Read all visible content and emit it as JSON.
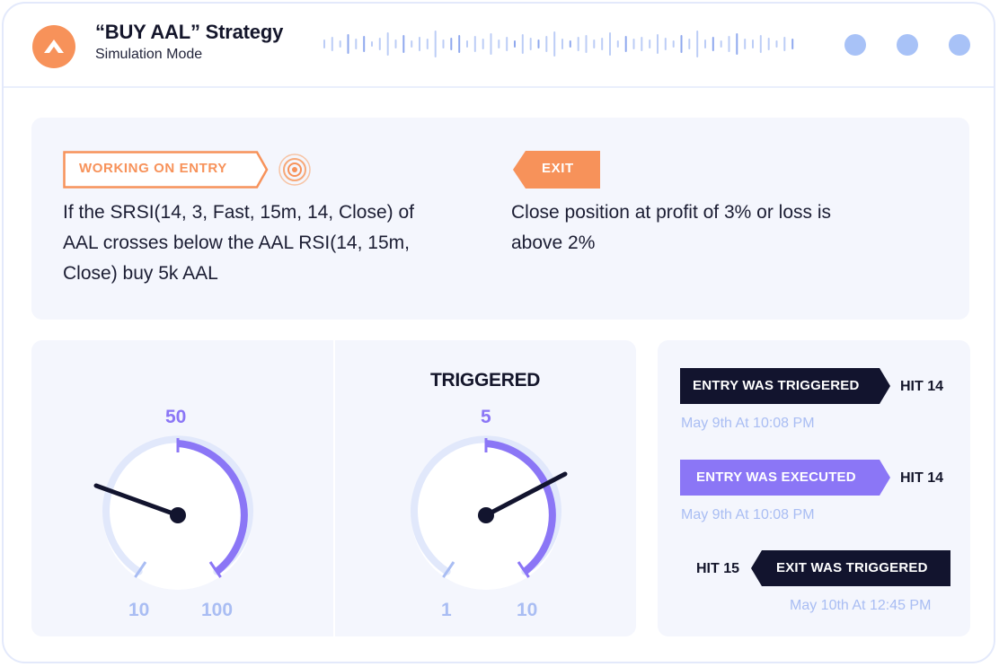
{
  "header": {
    "title": "“BUY AAL” Strategy",
    "subtitle": "Simulation Mode",
    "logo_icon": "triangle-logo-icon",
    "window_dots": 3
  },
  "strategy": {
    "entry": {
      "tag": "WORKING ON ENTRY",
      "rule_lines": [
        "If the SRSI(14, 3, Fast, 15m, 14, Close) of",
        "AAL crosses below the AAL RSI(14, 15m,",
        "Close) buy 5k AAL"
      ]
    },
    "exit": {
      "tag": "EXIT",
      "rule_lines": [
        "Close position at profit of 3% or loss is",
        "above 2%"
      ]
    }
  },
  "gauges": {
    "left": {
      "top_label": "50",
      "min_label": "10",
      "max_label": "100"
    },
    "right": {
      "heading": "TRIGGERED",
      "top_label": "5",
      "min_label": "1",
      "max_label": "10"
    }
  },
  "events": [
    {
      "label": "ENTRY WAS TRIGGERED",
      "hit": "HIT 14",
      "time": "May 9th At 10:08 PM",
      "color": "#12142e"
    },
    {
      "label": "ENTRY WAS EXECUTED",
      "hit": "HIT 14",
      "time": "May 9th At 10:08 PM",
      "color": "#8b76f6"
    },
    {
      "label": "EXIT WAS TRIGGERED",
      "hit": "HIT 15",
      "time": "May 10th At 12:45 PM",
      "color": "#12142e"
    }
  ],
  "colors": {
    "accent_orange": "#f7925a",
    "accent_purple": "#8b76f6",
    "navy": "#12142e",
    "soft_blue": "#a9bdf3",
    "card_bg": "#f4f6fd"
  }
}
